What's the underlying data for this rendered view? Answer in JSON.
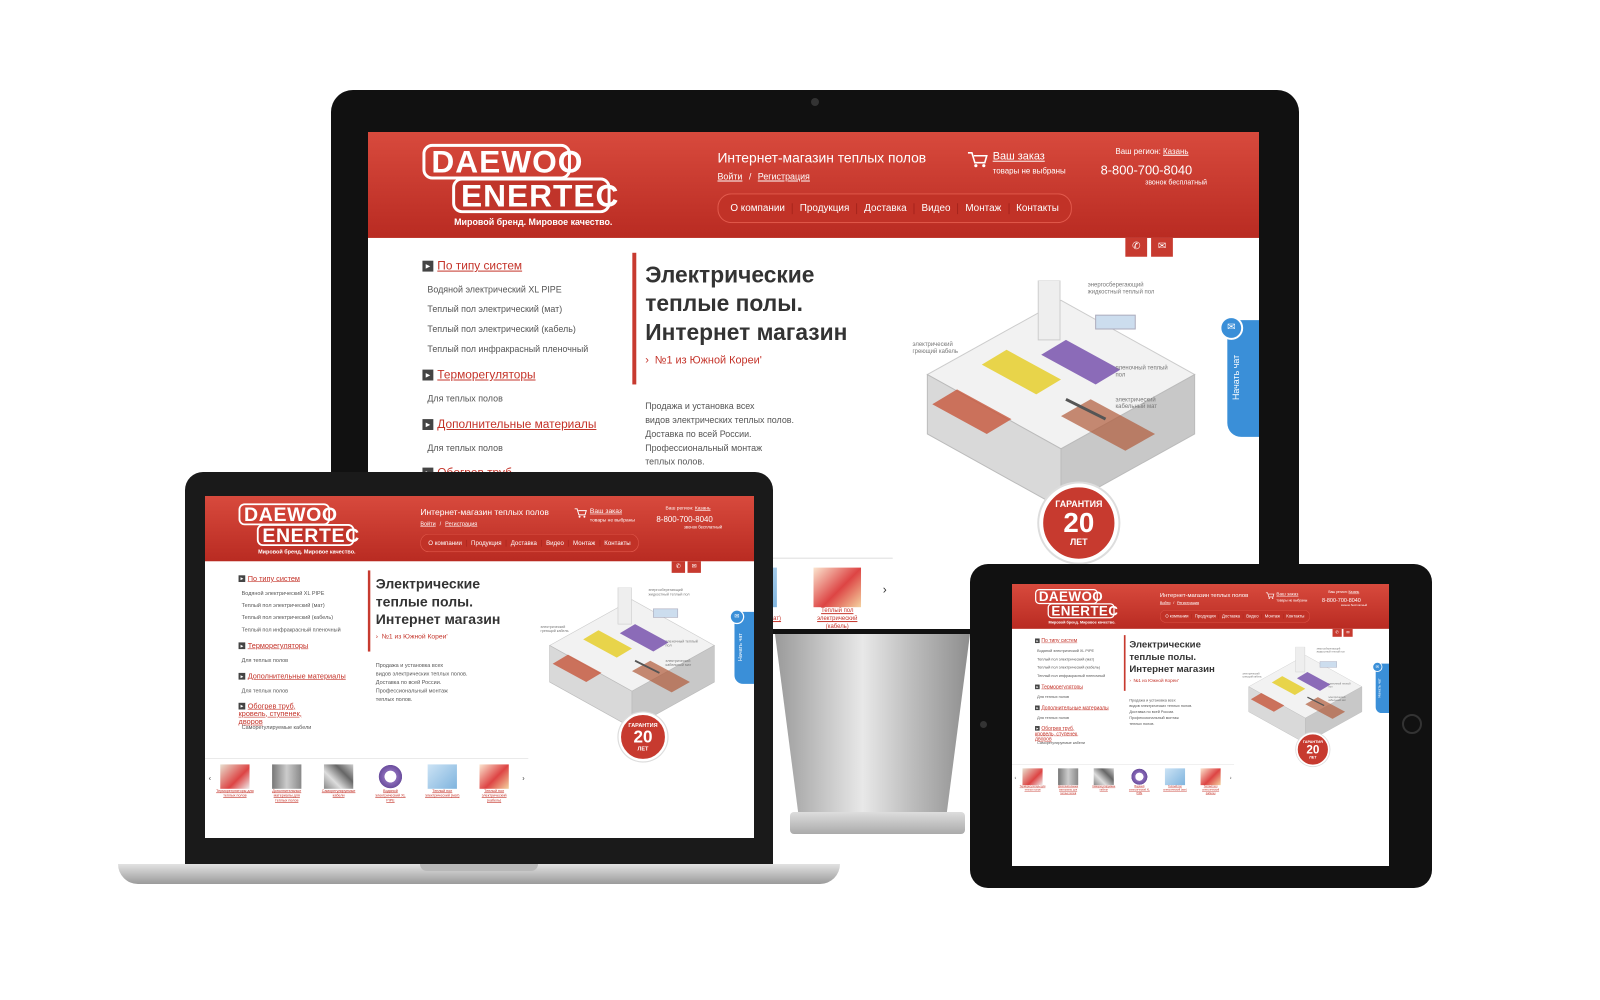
{
  "site": {
    "logo_line1": "DAEWOO",
    "logo_line2": "ENERTEC",
    "logo_tagline": "Мировой бренд. Мировое качество.",
    "shop_title": "Интернет-магазин теплых полов",
    "login": "Войти",
    "auth_sep": "/",
    "register": "Регистрация",
    "cart_title": "Ваш заказ",
    "cart_status": "товары не выбраны",
    "region_label": "Ваш регион:",
    "region_value": "Казань",
    "phone": "8-800-700-8040",
    "phone_note": "звонок бесплатный",
    "nav": [
      "О компании",
      "Продукция",
      "Доставка",
      "Видео",
      "Монтаж",
      "Контакты"
    ],
    "sidebar": {
      "cat1": "По типу систем",
      "cat1_items": [
        "Водяной электрический XL PIPE",
        "Теплый пол электрический (мат)",
        "Теплый пол электрический (кабель)",
        "Теплый пол инфракрасный пленочный"
      ],
      "cat2": "Терморегуляторы",
      "cat2_items": [
        "Для теплых полов"
      ],
      "cat3": "Дополнительные материалы",
      "cat3_items": [
        "Для теплых полов"
      ],
      "cat4": "Обогрев труб, кровель, ступенек, дворов",
      "cat4_items": [
        "Саморегулируемые кабели"
      ]
    },
    "hero": {
      "line1": "Электрические",
      "line2": "теплые полы.",
      "line3": "Интернет магазин",
      "kicker": "№1 из Южной Кореи'",
      "desc": [
        "Продажа и установка всех",
        "видов электрических теплых полов.",
        "Доставка по всей России.",
        "Профессиональный монтаж",
        "теплых полов."
      ]
    },
    "house_labels": [
      "энергосберегающий жидкостный теплый пол",
      "электрический греющий кабель",
      "пленочный теплый пол",
      "электрический кабельный мат"
    ],
    "seal": {
      "top": "ГАРАНТИЯ",
      "number": "20",
      "bottom": "ЛЕТ"
    },
    "chat": "Начать чат",
    "products": [
      "Терморегуляторы для теплых полов",
      "Дополнительные материалы для теплых полов",
      "Саморегулируемые кабели",
      "Водяной электрический XL PIPE",
      "Теплый пол электрический (мат)",
      "Теплый пол электрический (кабель)"
    ]
  },
  "colors": {
    "brand_red": "#c73a2f",
    "chat_blue": "#3a8fd8",
    "device_black": "#111111"
  },
  "icons": [
    "cart-icon",
    "phone-icon",
    "mail-icon",
    "chat-icon",
    "arrow-left-icon",
    "arrow-right-icon",
    "bullet-arrow-icon"
  ]
}
